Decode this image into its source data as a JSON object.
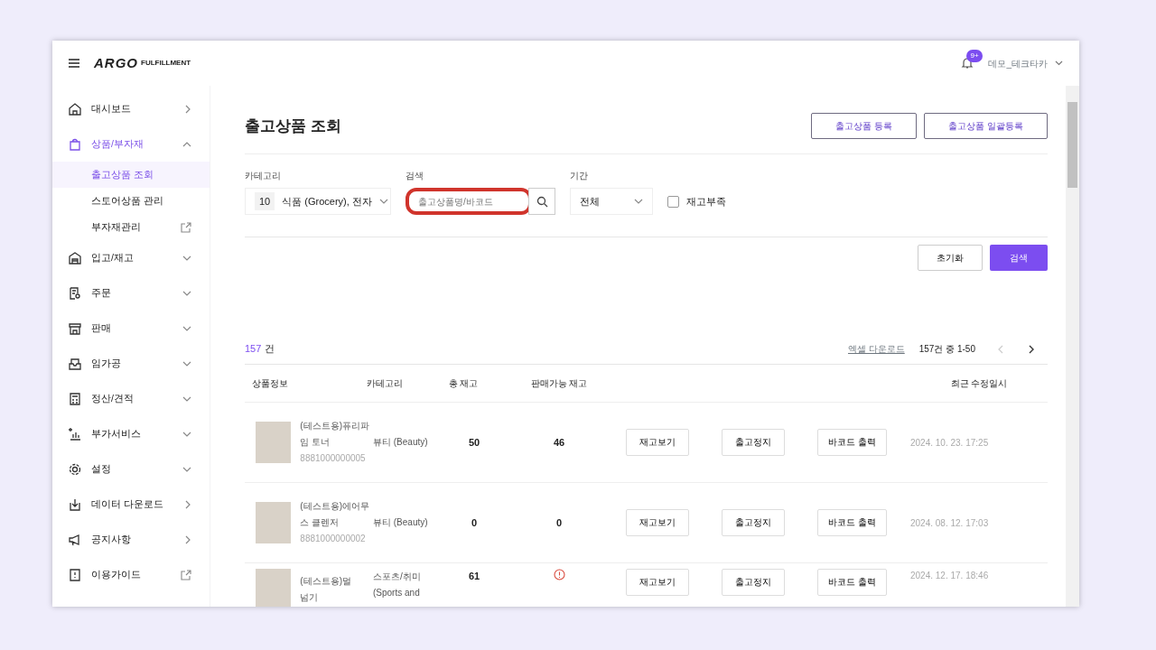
{
  "topbar": {
    "logo": "ARGO",
    "logo_sub": "FULFILLMENT",
    "notification_badge": "9+",
    "user": "데모_테크타카"
  },
  "sidebar": {
    "items": [
      {
        "label": "대시보드",
        "kind": "right",
        "selected": false
      },
      {
        "label": "상품/부자재",
        "kind": "up",
        "selected": true,
        "expanded": true,
        "children": [
          {
            "label": "출고상품 조회",
            "selected": true,
            "kind": "none"
          },
          {
            "label": "스토어상품 관리",
            "selected": false,
            "kind": "none"
          },
          {
            "label": "부자재관리",
            "selected": false,
            "kind": "external"
          }
        ]
      },
      {
        "label": "입고/재고",
        "kind": "down",
        "selected": false
      },
      {
        "label": "주문",
        "kind": "down",
        "selected": false
      },
      {
        "label": "판매",
        "kind": "down",
        "selected": false
      },
      {
        "label": "임가공",
        "kind": "down",
        "selected": false
      },
      {
        "label": "정산/견적",
        "kind": "down",
        "selected": false
      },
      {
        "label": "부가서비스",
        "kind": "down",
        "selected": false
      },
      {
        "label": "설정",
        "kind": "down",
        "selected": false
      },
      {
        "label": "데이터 다운로드",
        "kind": "right",
        "selected": false
      },
      {
        "label": "공지사항",
        "kind": "right",
        "selected": false
      },
      {
        "label": "이용가이드",
        "kind": "external",
        "selected": false
      }
    ]
  },
  "page": {
    "title": "출고상품 조회",
    "buttons": [
      "출고상품 등록",
      "출고상품 일괄등록"
    ]
  },
  "filters": {
    "category": {
      "label": "카테고리",
      "count": "10",
      "value": "식품 (Grocery), 전자"
    },
    "search": {
      "label": "검색",
      "placeholder": "출고상품명/바코드",
      "highlighted": true
    },
    "period": {
      "label": "기간",
      "value": "전체"
    },
    "low_stock": {
      "label": "재고부족",
      "checked": false
    },
    "reset": "초기화",
    "submit": "검색"
  },
  "results": {
    "count": "157",
    "count_unit": "건",
    "excel": "엑셀 다운로드",
    "range": "157건 중 1-50",
    "prev_disabled": true,
    "next_disabled": false
  },
  "table": {
    "columns": [
      "상품정보",
      "카테고리",
      "총 재고",
      "판매가능 재고",
      "최근 수정일시"
    ],
    "rows": [
      {
        "name_lines": [
          "(테스트용)퓨리파",
          "임 토너"
        ],
        "barcode": "8881000000005",
        "category": "뷰티 (Beauty)",
        "total": "50",
        "available": "46",
        "available_warning": false,
        "actions": [
          "재고보기",
          "출고정지",
          "바코드 출력"
        ],
        "updated": "2024. 10. 23. 17:25"
      },
      {
        "name_lines": [
          "(테스트용)에어무",
          "스 클렌저"
        ],
        "barcode": "8881000000002",
        "category": "뷰티 (Beauty)",
        "total": "0",
        "available": "0",
        "available_warning": false,
        "actions": [
          "재고보기",
          "출고정지",
          "바코드 출력"
        ],
        "updated": "2024. 08. 12. 17:03"
      },
      {
        "name_lines": [
          "(테스트용)멀",
          "넘기"
        ],
        "category": "스포츠/취미 (Sports and",
        "total": "61",
        "available_warning": true,
        "actions": [
          "재고보기",
          "출고정지",
          "바코드 출력"
        ],
        "updated": "2024. 12. 17. 18:46"
      }
    ]
  }
}
